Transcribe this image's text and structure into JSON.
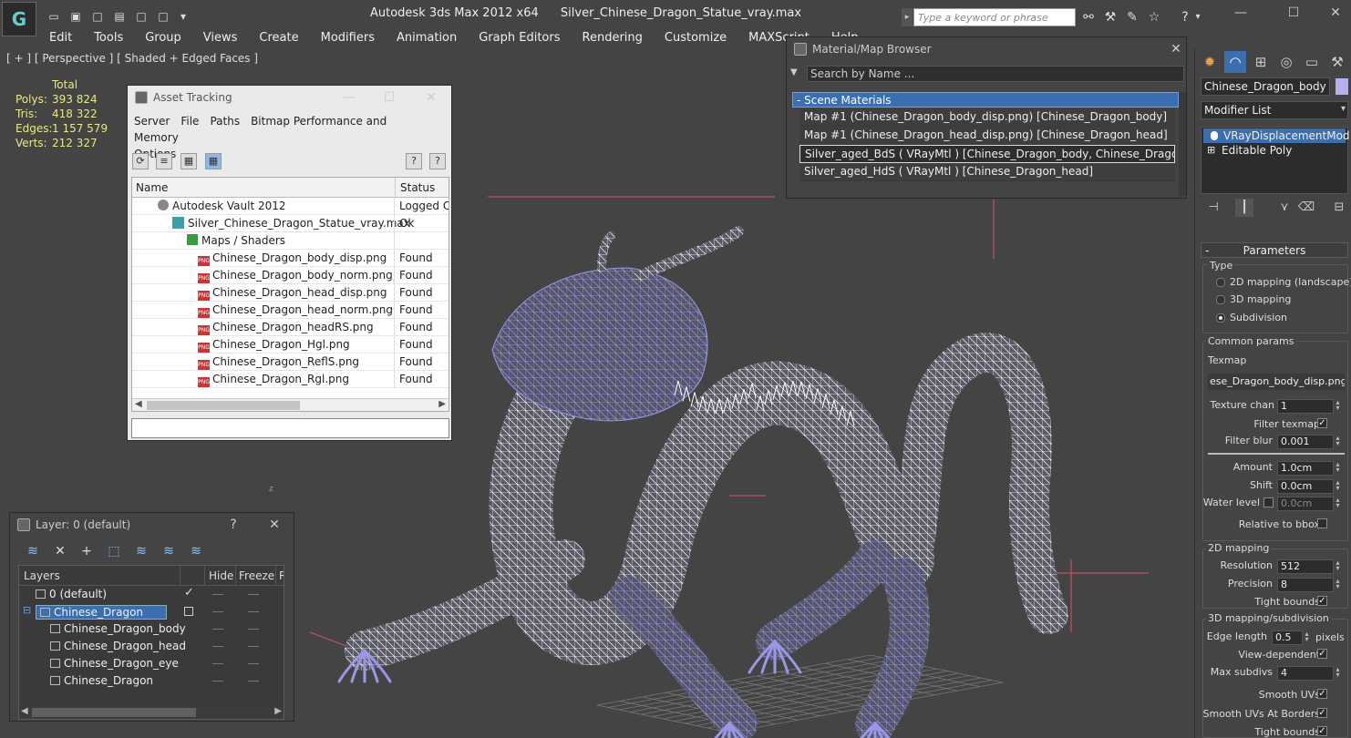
{
  "window": {
    "app_title": "Autodesk 3ds Max  2012 x64",
    "file_title": "Silver_Chinese_Dragon_Statue_vray.max",
    "search_placeholder": "Type a keyword or phrase"
  },
  "menu": [
    "Edit",
    "Tools",
    "Group",
    "Views",
    "Create",
    "Modifiers",
    "Animation",
    "Graph Editors",
    "Rendering",
    "Customize",
    "MAXScript",
    "Help"
  ],
  "viewport": {
    "label": "[ + ] [ Perspective ] [ Shaded + Edged Faces ]",
    "axis_label": "z",
    "stats": {
      "header": "Total",
      "rows": [
        {
          "k": "Polys:",
          "v": "393 824"
        },
        {
          "k": "Tris:",
          "v": "418 322"
        },
        {
          "k": "Edges:",
          "v": "1 157 579"
        },
        {
          "k": "Verts:",
          "v": "212 327"
        }
      ]
    }
  },
  "asset_tracking": {
    "title": "Asset Tracking",
    "menu_row1": [
      "Server",
      "File",
      "Paths",
      "Bitmap Performance and Memory"
    ],
    "menu_row2": [
      "Options"
    ],
    "col_name": "Name",
    "col_status": "Status",
    "rows": [
      {
        "name": "Autodesk Vault 2012",
        "status": "Logged Ou",
        "icon": "gear-icon"
      },
      {
        "name": "Silver_Chinese_Dragon_Statue_vray.max",
        "status": "Ok",
        "icon": "max-file-icon"
      },
      {
        "name": "Maps / Shaders",
        "status": "",
        "icon": "maps-icon"
      },
      {
        "name": "Chinese_Dragon_body_disp.png",
        "status": "Found",
        "icon": "png-icon"
      },
      {
        "name": "Chinese_Dragon_body_norm.png",
        "status": "Found",
        "icon": "png-icon"
      },
      {
        "name": "Chinese_Dragon_head_disp.png",
        "status": "Found",
        "icon": "png-icon"
      },
      {
        "name": "Chinese_Dragon_head_norm.png",
        "status": "Found",
        "icon": "png-icon"
      },
      {
        "name": "Chinese_Dragon_headRS.png",
        "status": "Found",
        "icon": "png-icon"
      },
      {
        "name": "Chinese_Dragon_Hgl.png",
        "status": "Found",
        "icon": "png-icon"
      },
      {
        "name": "Chinese_Dragon_ReflS.png",
        "status": "Found",
        "icon": "png-icon"
      },
      {
        "name": "Chinese_Dragon_Rgl.png",
        "status": "Found",
        "icon": "png-icon"
      }
    ],
    "png_badge": "PNG"
  },
  "material_browser": {
    "title": "Material/Map Browser",
    "search_placeholder": "Search by Name ...",
    "group": "- Scene Materials",
    "items": [
      "Map #1 (Chinese_Dragon_body_disp.png) [Chinese_Dragon_body]",
      "Map #1 (Chinese_Dragon_head_disp.png) [Chinese_Dragon_head]",
      "Silver_aged_BdS ( VRayMtl ) [Chinese_Dragon_body, Chinese_Dragon_eye]",
      "Silver_aged_HdS ( VRayMtl ) [Chinese_Dragon_head]"
    ]
  },
  "layers": {
    "title": "Layer: 0 (default)",
    "help": "?",
    "col_layers": "Layers",
    "col_hide": "Hide",
    "col_freeze": "Freeze",
    "col_r": "R",
    "rows": [
      {
        "name": "0 (default)",
        "indent": 1
      },
      {
        "name": "Chinese_Dragon",
        "indent": 1
      },
      {
        "name": "Chinese_Dragon_body",
        "indent": 2
      },
      {
        "name": "Chinese_Dragon_head",
        "indent": 2
      },
      {
        "name": "Chinese_Dragon_eye",
        "indent": 2
      },
      {
        "name": "Chinese_Dragon",
        "indent": 2
      }
    ]
  },
  "command_panel": {
    "object_name": "Chinese_Dragon_body",
    "object_color": "#b3b0ee",
    "modifier_list": "Modifier List",
    "stack": [
      "VRayDisplacementMod",
      "Editable Poly"
    ],
    "parameters": "Parameters",
    "type_label": "Type",
    "type_options": [
      "2D mapping (landscape)",
      "3D mapping",
      "Subdivision"
    ],
    "type_selected": 2,
    "common_params": "Common params",
    "texmap_label": "Texmap",
    "texmap_value": "ese_Dragon_body_disp.png)",
    "texture_chan_label": "Texture chan",
    "texture_chan": "1",
    "filter_texmap_label": "Filter texmap",
    "filter_blur_label": "Filter blur",
    "filter_blur": "0.001",
    "amount_label": "Amount",
    "amount": "1.0cm",
    "shift_label": "Shift",
    "shift": "0.0cm",
    "water_level_label": "Water level",
    "water_level": "0.0cm",
    "relative_bbox_label": "Relative to bbox",
    "mapping2d": "2D mapping",
    "resolution_label": "Resolution",
    "resolution": "512",
    "precision_label": "Precision",
    "precision": "8",
    "tight_bounds_label": "Tight bounds",
    "mapping3d": "3D mapping/subdivision",
    "edge_length_label": "Edge length",
    "edge_length": "0.5",
    "pixels_label": "pixels",
    "view_dependent_label": "View-dependent",
    "max_subdivs_label": "Max subdivs",
    "max_subdivs": "4",
    "smooth_uvs_label": "Smooth UVs",
    "smooth_uvs_borders_label": "Smooth UVs At Borders",
    "tight_bounds2_label": "Tight bounds",
    "check_mark": "✓"
  },
  "colors": {
    "wire": "#ffffff",
    "wire_shaded": "#9a98e6",
    "selection_blue": "#3b6fb0",
    "stats_yellow": "#e8e88a"
  }
}
